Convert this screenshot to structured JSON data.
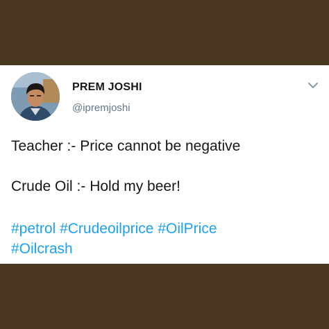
{
  "tweet": {
    "display_name": "PREM JOSHI",
    "handle": "@ipremjoshi",
    "lines": [
      "Teacher :- Price cannot be negative",
      "Crude Oil :- Hold my beer!"
    ],
    "hashtags": [
      "#petrol",
      "#Crudeoilprice",
      "#OilPrice",
      "#Oilcrash"
    ]
  },
  "icons": {
    "avatar": "profile-photo",
    "menu": "chevron-down-icon"
  },
  "colors": {
    "frame": "#4a3820",
    "card": "#ffffff",
    "text": "#14171a",
    "handle": "#657786",
    "hashtag": "#1da1f2"
  }
}
